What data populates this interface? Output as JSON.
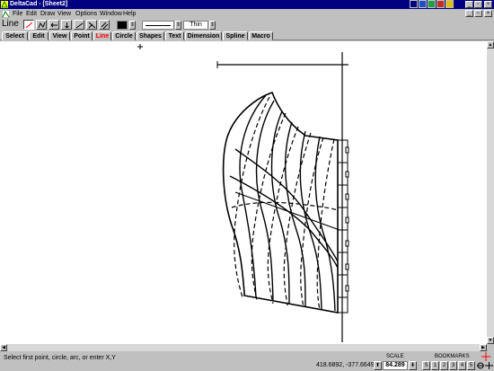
{
  "window": {
    "title": "DeltaCad - [Sheet2]",
    "minimize": "_",
    "restore": "▫",
    "close": "×"
  },
  "menu": {
    "items": [
      "File",
      "Edit",
      "Draw",
      "View",
      "Options",
      "Window",
      "Help"
    ]
  },
  "toolbar": {
    "tool_name": "Line",
    "line_width": "Thin",
    "color": "#000000",
    "buttons": [
      "line-tool",
      "polyline-tool",
      "horizontal-line-tool",
      "vertical-line-tool",
      "angle-line-tool",
      "perpendicular-line-tool",
      "parallel-line-tool"
    ]
  },
  "tabs": {
    "items": [
      "Select",
      "Edit",
      "View",
      "Point",
      "Line",
      "Circle",
      "Shapes",
      "Text",
      "Dimension",
      "Spline",
      "Macro"
    ],
    "active": "Line",
    "active_color": "#ff0000"
  },
  "status": {
    "message": "Select first point, circle, arc, or enter X,Y",
    "coordinates": "418.6892, -377.6649",
    "scale_label": "SCALE",
    "scale_value": "84.289",
    "bookmarks_label": "BOOKMARKS",
    "bookmarks": [
      "S",
      "1",
      "2",
      "3",
      "4",
      "5"
    ]
  },
  "colors": {
    "title_bar": "#000080",
    "chrome": "#c0c0c0",
    "canvas": "#ffffff"
  }
}
